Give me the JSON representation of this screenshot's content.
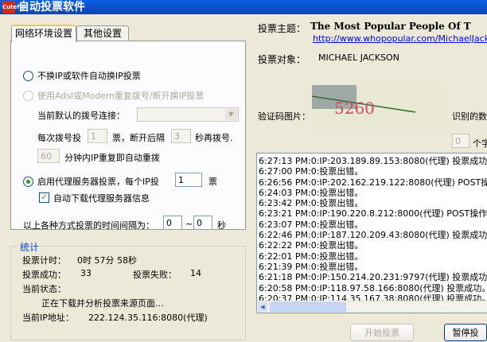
{
  "window": {
    "title": "自动投票软件",
    "app_icon_text": "Cuteftp"
  },
  "tabs": [
    {
      "label": "网络环境设置",
      "active": true
    },
    {
      "label": "其他设置",
      "active": false
    }
  ],
  "network": {
    "opt_no_ip": "不换IP或软件自动换IP投票",
    "opt_adsl": "使用Adsl或Modem重复拨号/断开换IP投票",
    "dial_conn_label": "当前默认的拨号连接：",
    "dial_conn_value": "",
    "per_dial_label": "每次拨号投",
    "per_dial_value": "1",
    "per_dial_suffix": "票，断开后隔",
    "reconnect_value": "3",
    "reconnect_suffix": "秒再拨号.",
    "redial_value": "60",
    "redial_suffix": "分钟内IP重复即自动重拨",
    "opt_proxy": "启用代理服务器投票，每个IP投",
    "proxy_votes": "1",
    "proxy_votes_suffix": "票",
    "auto_download": "自动下载代理服务器信息",
    "interval_label": "以上各种方式投票的时间间隔为：",
    "interval_min": "0",
    "interval_sep": "~",
    "interval_max": "0",
    "interval_unit": "秒"
  },
  "stats": {
    "title": "统计",
    "timer_label": "投票计时：",
    "timer_value": "0时 57分 58秒",
    "success_label": "投票成功：",
    "success_value": "33",
    "fail_label": "投票失败：",
    "fail_value": "14",
    "status_label": "当前状态：",
    "status_value": "正在下载并分析投票来源页面...",
    "ip_label": "当前IP地址：",
    "ip_value": "222.124.35.116:8080(代理)"
  },
  "vote": {
    "topic_label": "投票主题：",
    "topic_value": "The Most Popular People Of T",
    "topic_url": "http://www.whopopular.com/MichaelJackson",
    "target_label": "投票对象：",
    "target_value": "MICHAEL JACKSON",
    "captcha_label": "验证码图片：",
    "captcha_text": "5260",
    "recognized_label": "识别的数",
    "digit_count_value": "0",
    "digit_count_suffix": "个字"
  },
  "log": [
    "6:27:13 PM:0:IP:203.189.89.153:8080(代理) 投票成功。",
    "6:27:00 PM:0:投票出错。",
    "6:26:56 PM:0:IP:202.162.219.122:8080(代理) POST操作出",
    "6:24:03 PM:0:投票出错。",
    "6:23:42 PM:0:投票出错。",
    "6:23:21 PM:0:IP:190.220.8.212:8000(代理) POST操作出错",
    "6:23:07 PM:0:投票出错。",
    "6:22:46 PM:0:IP:187.120.209.43:8080(代理) 投票成功。",
    "6:22:22 PM:0:投票出错。",
    "6:22:01 PM:0:投票出错。",
    "6:21:39 PM:0:投票出错。",
    "6:21:18 PM:0:IP:150.214.20.231:9797(代理) 投票成功。",
    "6:20:58 PM:0:IP:118.97.58.166:8080(代理) 投票成功。",
    "6:20:37 PM:0:IP:114.35.167.38:8080(代理) 投票成功。"
  ],
  "buttons": {
    "start": "开始投票",
    "stop": "暂停投"
  },
  "colors": {
    "title_bar": "#0A5FE0",
    "radio_dot": "#21A121",
    "link": "#0000FF",
    "group_title": "#0046D5"
  }
}
